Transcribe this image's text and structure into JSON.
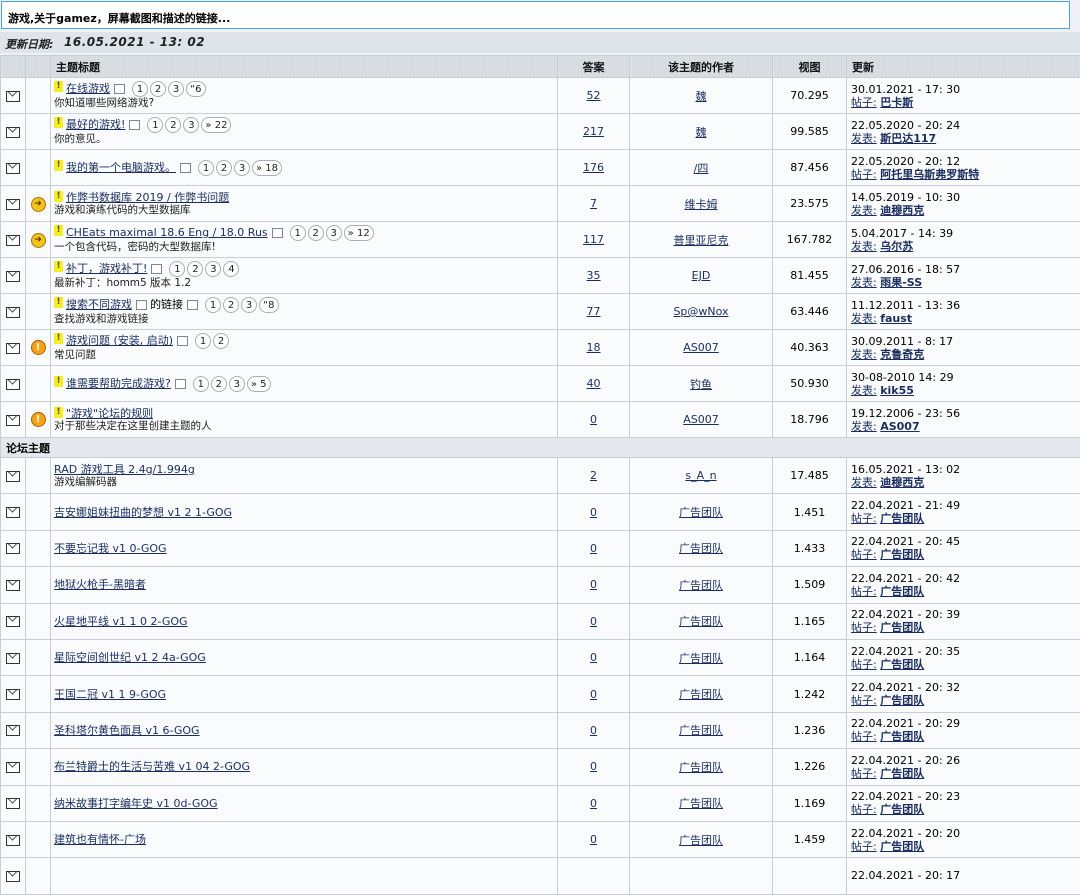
{
  "header": {
    "title": "游戏,关于gamez，屏幕截图和描述的链接...",
    "update_label": "更新日期:",
    "update_value": "16.05.2021 - 13: 02"
  },
  "columns": {
    "topic": "主题标题",
    "replies": "答案",
    "author": "该主题的作者",
    "views": "视图",
    "updated": "更新"
  },
  "sticky": [
    {
      "icon2": "",
      "title": "在线游戏",
      "sub": "你知道哪些网络游戏?",
      "pages": [
        "1",
        "2",
        "3",
        "“6"
      ],
      "replies": "52",
      "author": "魏",
      "views": "70.295",
      "date": "30.01.2021 - 17: 30",
      "by_label": "帖子:",
      "by": "巴卡斯"
    },
    {
      "icon2": "",
      "title": "最好的游戏!",
      "sub": "你的意见。",
      "pages": [
        "1",
        "2",
        "3",
        "» 22"
      ],
      "replies": "217",
      "author": "魏",
      "views": "99.585",
      "date": "22.05.2020 - 20: 24",
      "by_label": "发表:",
      "by": "斯巴达117"
    },
    {
      "icon2": "",
      "title": "我的第一个电脑游戏。",
      "sub": "",
      "pages": [
        "1",
        "2",
        "3",
        "» 18"
      ],
      "replies": "176",
      "author": "/四",
      "views": "87.456",
      "date": "22.05.2020 - 20: 12",
      "by_label": "帖子:",
      "by": "阿托里乌斯弗罗斯特"
    },
    {
      "icon2": "arrow",
      "title": "作弊书数据库 2019 / 作弊书问题",
      "sub": "游戏和演练代码的大型数据库",
      "pages": [],
      "replies": "7",
      "author": "维卡姆",
      "views": "23.575",
      "date": "14.05.2019 - 10: 30",
      "by_label": "发表:",
      "by": "迪穆西克"
    },
    {
      "icon2": "arrow",
      "title": "CHEats maximal 18.6 Eng / 18.0 Rus",
      "sub": "一个包含代码，密码的大型数据库!",
      "pages": [
        "1",
        "2",
        "3",
        "» 12"
      ],
      "replies": "117",
      "author": "普里亚尼克",
      "views": "167.782",
      "date": "5.04.2017 - 14: 39",
      "by_label": "发表:",
      "by": "乌尔苏"
    },
    {
      "icon2": "",
      "title": "补丁，游戏补丁!",
      "sub": "最新补丁：homm5 版本 1.2",
      "pages": [
        "1",
        "2",
        "3",
        "4"
      ],
      "replies": "35",
      "author": "EJD",
      "views": "81.455",
      "date": "27.06.2016 - 18: 57",
      "by_label": "发表:",
      "by": "雨果-SS"
    },
    {
      "icon2": "",
      "title": "搜索不同游戏",
      "title2": "的链接",
      "sub": "查找游戏和游戏链接",
      "pages": [
        "1",
        "2",
        "3",
        "“8"
      ],
      "replies": "77",
      "author": "Sp@wNox",
      "views": "63.446",
      "date": "11.12.2011 - 13: 36",
      "by_label": "发表:",
      "by": "faust"
    },
    {
      "icon2": "warn",
      "title": "游戏问题 (安装, 启动)",
      "sub": "常见问题",
      "pages": [
        "1",
        "2"
      ],
      "replies": "18",
      "author": "AS007",
      "views": "40.363",
      "date": "30.09.2011 - 8: 17",
      "by_label": "发表:",
      "by": "克鲁奇克"
    },
    {
      "icon2": "",
      "title": "谁需要帮助完成游戏?",
      "sub": "",
      "pages": [
        "1",
        "2",
        "3",
        "» 5"
      ],
      "replies": "40",
      "author": "钓鱼",
      "views": "50.930",
      "date": "30-08-2010 14: 29",
      "by_label": "发表:",
      "by": "kik55"
    },
    {
      "icon2": "warn",
      "title": "\"游戏\"论坛的规则",
      "sub": "对于那些决定在这里创建主题的人",
      "pages": [],
      "replies": "0",
      "author": "AS007",
      "views": "18.796",
      "date": "19.12.2006 - 23: 56",
      "by_label": "发表:",
      "by": "AS007"
    }
  ],
  "section_label": "论坛主题",
  "topics": [
    {
      "title": "RAD 游戏工具 2.4g/1.994g",
      "sub": "游戏编解码器",
      "replies": "2",
      "author": "s_A_n",
      "views": "17.485",
      "date": "16.05.2021 - 13: 02",
      "by_label": "发表:",
      "by": "迪穆西克"
    },
    {
      "title": "吉安娜姐妹扭曲的梦想 v1 2 1-GOG",
      "sub": "",
      "replies": "0",
      "author": "广告团队",
      "views": "1.451",
      "date": "22.04.2021 - 21: 49",
      "by_label": "帖子:",
      "by": "广告团队"
    },
    {
      "title": "不要忘记我 v1 0-GOG",
      "sub": "",
      "replies": "0",
      "author": "广告团队",
      "views": "1.433",
      "date": "22.04.2021 - 20: 45",
      "by_label": "帖子:",
      "by": "广告团队"
    },
    {
      "title": "地狱火枪手-黑暗者",
      "sub": "",
      "replies": "0",
      "author": "广告团队",
      "views": "1.509",
      "date": "22.04.2021 - 20: 42",
      "by_label": "帖子:",
      "by": "广告团队"
    },
    {
      "title": "火星地平线 v1 1 0 2-GOG",
      "sub": "",
      "replies": "0",
      "author": "广告团队",
      "views": "1.165",
      "date": "22.04.2021 - 20: 39",
      "by_label": "帖子:",
      "by": "广告团队"
    },
    {
      "title": "星际空间创世纪 v1 2 4a-GOG",
      "sub": "",
      "replies": "0",
      "author": "广告团队",
      "views": "1.164",
      "date": "22.04.2021 - 20: 35",
      "by_label": "帖子:",
      "by": "广告团队"
    },
    {
      "title": "王国二冠 v1 1 9-GOG",
      "sub": "",
      "replies": "0",
      "author": "广告团队",
      "views": "1.242",
      "date": "22.04.2021 - 20: 32",
      "by_label": "帖子:",
      "by": "广告团队"
    },
    {
      "title": "圣科塔尔黄色面具 v1 6-GOG",
      "sub": "",
      "replies": "0",
      "author": "广告团队",
      "views": "1.236",
      "date": "22.04.2021 - 20: 29",
      "by_label": "帖子:",
      "by": "广告团队"
    },
    {
      "title": "布兰特爵士的生活与苦难 v1 04 2-GOG",
      "sub": "",
      "replies": "0",
      "author": "广告团队",
      "views": "1.226",
      "date": "22.04.2021 - 20: 26",
      "by_label": "帖子:",
      "by": "广告团队"
    },
    {
      "title": "纳米故事打字编年史 v1 0d-GOG",
      "sub": "",
      "replies": "0",
      "author": "广告团队",
      "views": "1.169",
      "date": "22.04.2021 - 20: 23",
      "by_label": "帖子:",
      "by": "广告团队"
    },
    {
      "title": "建筑也有情怀-广场",
      "sub": "",
      "replies": "0",
      "author": "广告团队",
      "views": "1.459",
      "date": "22.04.2021 - 20: 20",
      "by_label": "帖子:",
      "by": "广告团队"
    },
    {
      "title": "",
      "sub": "",
      "replies": "",
      "author": "",
      "views": "",
      "date": "22.04.2021 - 20: 17",
      "by_label": "",
      "by": ""
    }
  ]
}
